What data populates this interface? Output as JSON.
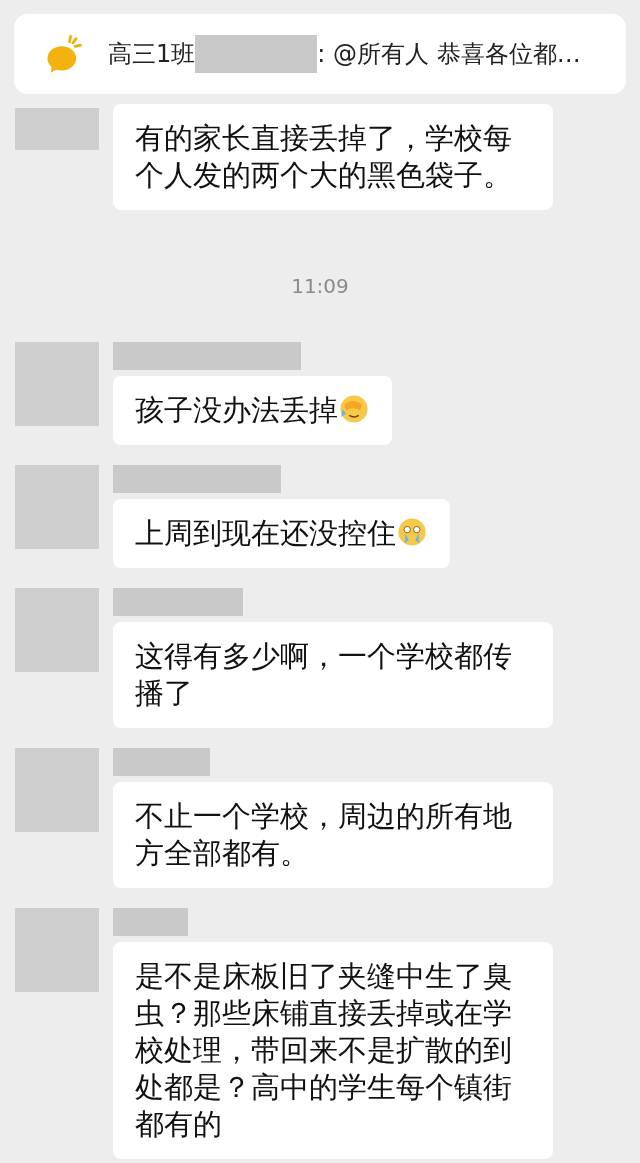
{
  "pinned": {
    "prefix": "高三1班",
    "redacted": true,
    "suffix": ": @所有人 恭喜各位都…"
  },
  "messages": [
    {
      "avatar_cut": true,
      "name_redacted": false,
      "text": "有的家长直接丢掉了，学校每个人发的两个大的黑色袋子。",
      "emoji": false
    },
    {
      "kind": "time",
      "text": "11:09"
    },
    {
      "avatar_cut": false,
      "name_redacted": true,
      "text": "孩子没办法丢掉",
      "emoji": true
    },
    {
      "avatar_cut": false,
      "name_redacted": true,
      "text": "上周到现在还没控住",
      "emoji": true
    },
    {
      "avatar_cut": false,
      "name_redacted": true,
      "text": "这得有多少啊，一个学校都传播了",
      "emoji": false
    },
    {
      "avatar_cut": false,
      "name_redacted": true,
      "text": "不止一个学校，周边的所有地方全部都有。",
      "emoji": false
    },
    {
      "avatar_cut": false,
      "name_redacted": true,
      "text": "是不是床板旧了夹缝中生了臭虫？那些床铺直接丢掉或在学校处理，带回来不是扩散的到处都是？高中的学生每个镇街都有的",
      "emoji": false
    }
  ]
}
